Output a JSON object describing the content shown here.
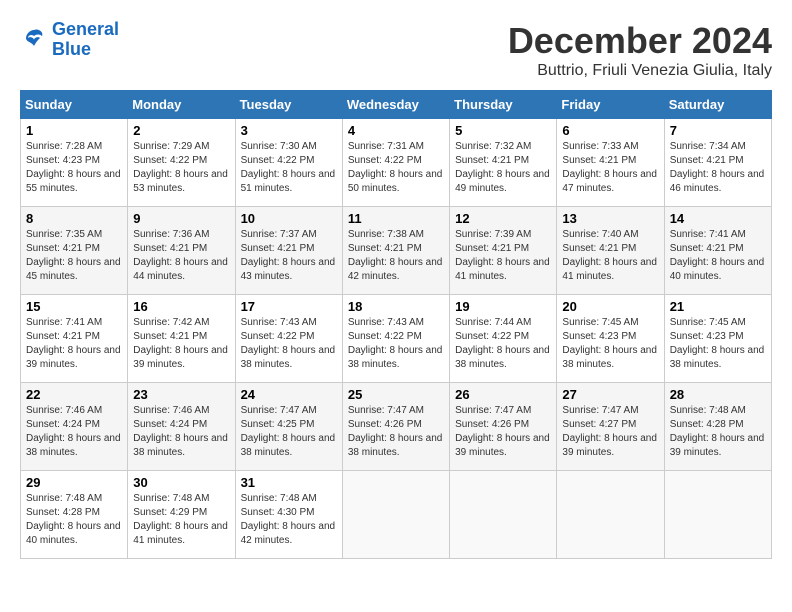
{
  "logo": {
    "line1": "General",
    "line2": "Blue"
  },
  "title": "December 2024",
  "subtitle": "Buttrio, Friuli Venezia Giulia, Italy",
  "weekdays": [
    "Sunday",
    "Monday",
    "Tuesday",
    "Wednesday",
    "Thursday",
    "Friday",
    "Saturday"
  ],
  "weeks": [
    [
      {
        "day": "1",
        "sunrise": "7:28 AM",
        "sunset": "4:23 PM",
        "daylight": "8 hours and 55 minutes."
      },
      {
        "day": "2",
        "sunrise": "7:29 AM",
        "sunset": "4:22 PM",
        "daylight": "8 hours and 53 minutes."
      },
      {
        "day": "3",
        "sunrise": "7:30 AM",
        "sunset": "4:22 PM",
        "daylight": "8 hours and 51 minutes."
      },
      {
        "day": "4",
        "sunrise": "7:31 AM",
        "sunset": "4:22 PM",
        "daylight": "8 hours and 50 minutes."
      },
      {
        "day": "5",
        "sunrise": "7:32 AM",
        "sunset": "4:21 PM",
        "daylight": "8 hours and 49 minutes."
      },
      {
        "day": "6",
        "sunrise": "7:33 AM",
        "sunset": "4:21 PM",
        "daylight": "8 hours and 47 minutes."
      },
      {
        "day": "7",
        "sunrise": "7:34 AM",
        "sunset": "4:21 PM",
        "daylight": "8 hours and 46 minutes."
      }
    ],
    [
      {
        "day": "8",
        "sunrise": "7:35 AM",
        "sunset": "4:21 PM",
        "daylight": "8 hours and 45 minutes."
      },
      {
        "day": "9",
        "sunrise": "7:36 AM",
        "sunset": "4:21 PM",
        "daylight": "8 hours and 44 minutes."
      },
      {
        "day": "10",
        "sunrise": "7:37 AM",
        "sunset": "4:21 PM",
        "daylight": "8 hours and 43 minutes."
      },
      {
        "day": "11",
        "sunrise": "7:38 AM",
        "sunset": "4:21 PM",
        "daylight": "8 hours and 42 minutes."
      },
      {
        "day": "12",
        "sunrise": "7:39 AM",
        "sunset": "4:21 PM",
        "daylight": "8 hours and 41 minutes."
      },
      {
        "day": "13",
        "sunrise": "7:40 AM",
        "sunset": "4:21 PM",
        "daylight": "8 hours and 41 minutes."
      },
      {
        "day": "14",
        "sunrise": "7:41 AM",
        "sunset": "4:21 PM",
        "daylight": "8 hours and 40 minutes."
      }
    ],
    [
      {
        "day": "15",
        "sunrise": "7:41 AM",
        "sunset": "4:21 PM",
        "daylight": "8 hours and 39 minutes."
      },
      {
        "day": "16",
        "sunrise": "7:42 AM",
        "sunset": "4:21 PM",
        "daylight": "8 hours and 39 minutes."
      },
      {
        "day": "17",
        "sunrise": "7:43 AM",
        "sunset": "4:22 PM",
        "daylight": "8 hours and 38 minutes."
      },
      {
        "day": "18",
        "sunrise": "7:43 AM",
        "sunset": "4:22 PM",
        "daylight": "8 hours and 38 minutes."
      },
      {
        "day": "19",
        "sunrise": "7:44 AM",
        "sunset": "4:22 PM",
        "daylight": "8 hours and 38 minutes."
      },
      {
        "day": "20",
        "sunrise": "7:45 AM",
        "sunset": "4:23 PM",
        "daylight": "8 hours and 38 minutes."
      },
      {
        "day": "21",
        "sunrise": "7:45 AM",
        "sunset": "4:23 PM",
        "daylight": "8 hours and 38 minutes."
      }
    ],
    [
      {
        "day": "22",
        "sunrise": "7:46 AM",
        "sunset": "4:24 PM",
        "daylight": "8 hours and 38 minutes."
      },
      {
        "day": "23",
        "sunrise": "7:46 AM",
        "sunset": "4:24 PM",
        "daylight": "8 hours and 38 minutes."
      },
      {
        "day": "24",
        "sunrise": "7:47 AM",
        "sunset": "4:25 PM",
        "daylight": "8 hours and 38 minutes."
      },
      {
        "day": "25",
        "sunrise": "7:47 AM",
        "sunset": "4:26 PM",
        "daylight": "8 hours and 38 minutes."
      },
      {
        "day": "26",
        "sunrise": "7:47 AM",
        "sunset": "4:26 PM",
        "daylight": "8 hours and 39 minutes."
      },
      {
        "day": "27",
        "sunrise": "7:47 AM",
        "sunset": "4:27 PM",
        "daylight": "8 hours and 39 minutes."
      },
      {
        "day": "28",
        "sunrise": "7:48 AM",
        "sunset": "4:28 PM",
        "daylight": "8 hours and 39 minutes."
      }
    ],
    [
      {
        "day": "29",
        "sunrise": "7:48 AM",
        "sunset": "4:28 PM",
        "daylight": "8 hours and 40 minutes."
      },
      {
        "day": "30",
        "sunrise": "7:48 AM",
        "sunset": "4:29 PM",
        "daylight": "8 hours and 41 minutes."
      },
      {
        "day": "31",
        "sunrise": "7:48 AM",
        "sunset": "4:30 PM",
        "daylight": "8 hours and 42 minutes."
      },
      null,
      null,
      null,
      null
    ]
  ]
}
